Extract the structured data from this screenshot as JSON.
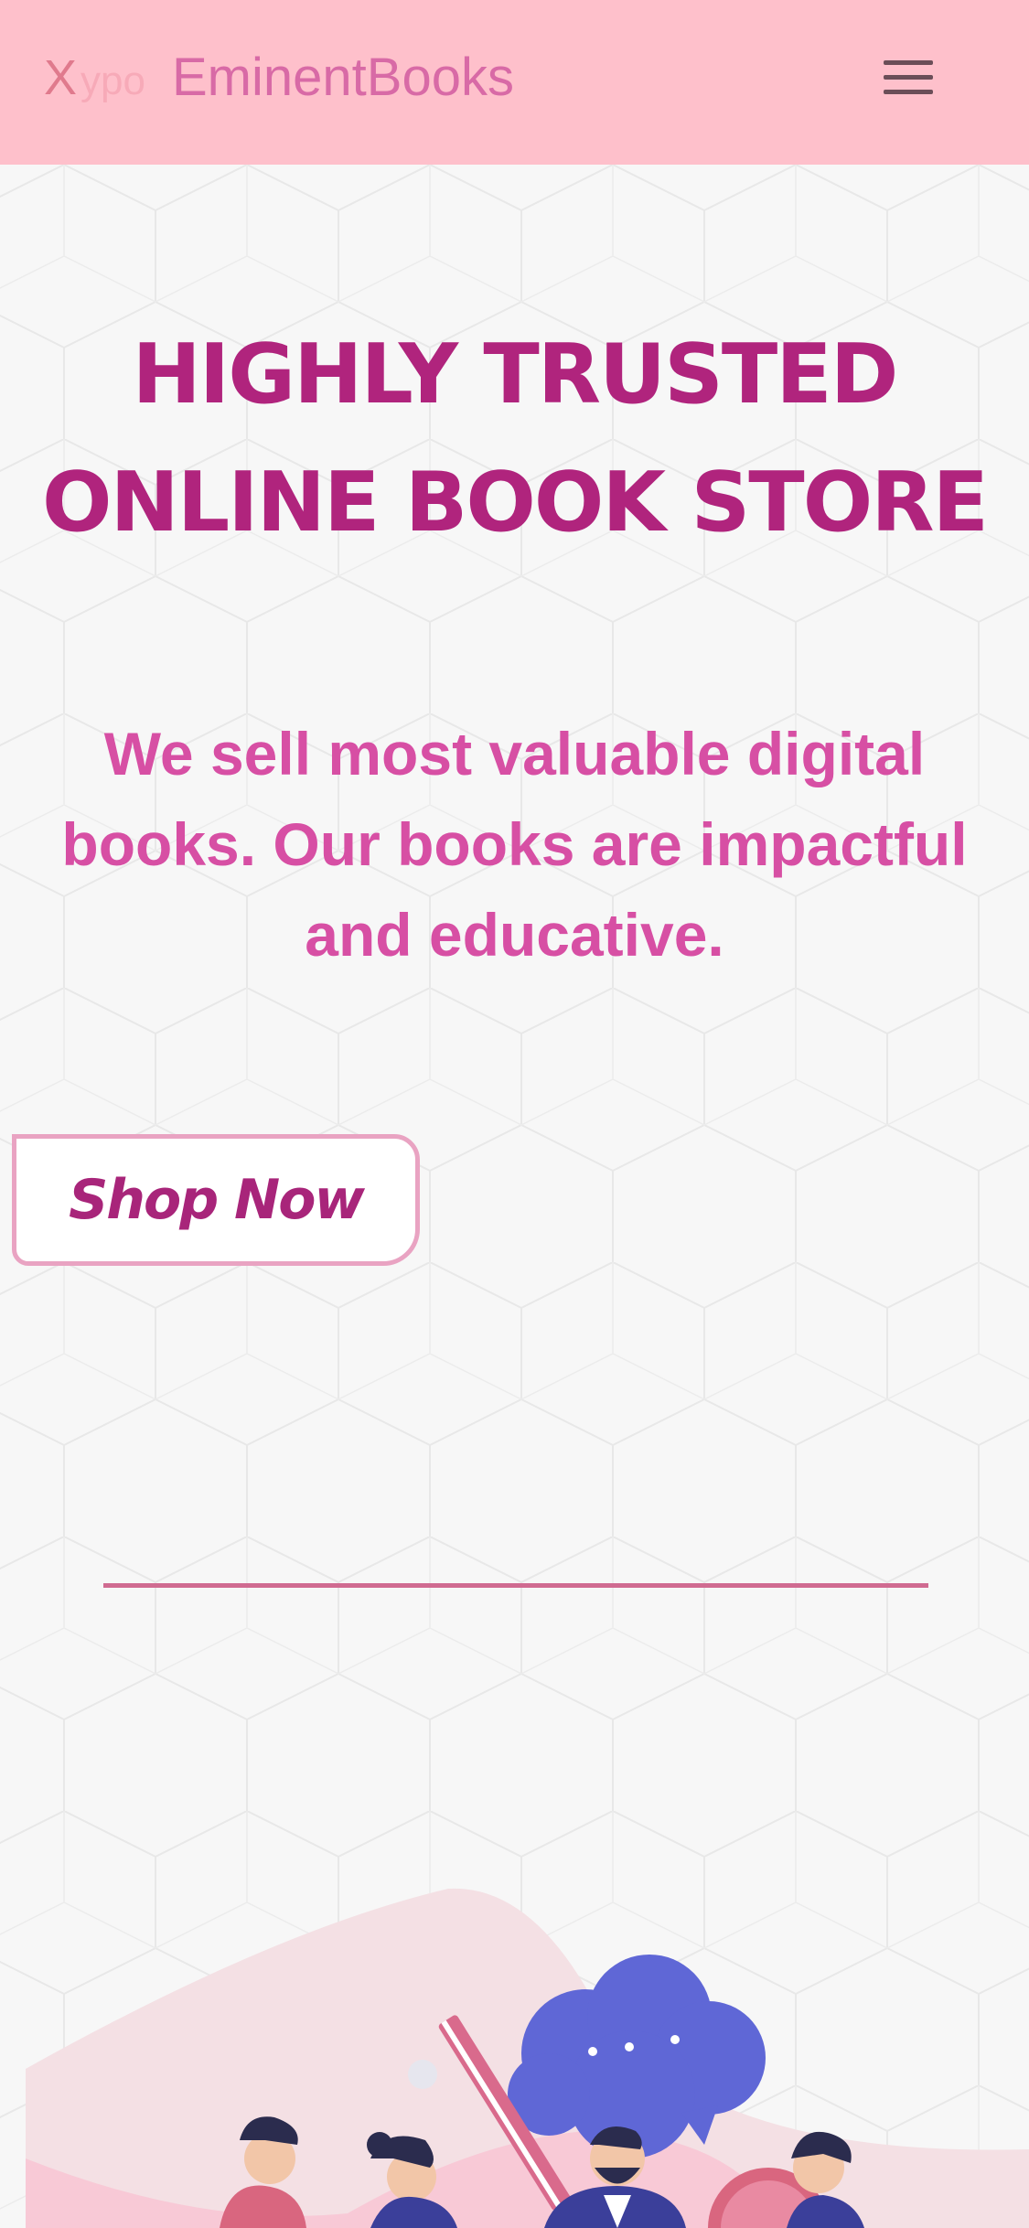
{
  "navbar": {
    "logo_x": "X",
    "logo_ypo": "ypo",
    "brand": "EminentBooks",
    "menu_icon": "hamburger-menu-icon"
  },
  "hero": {
    "title_line1": "HIGHLY TRUSTED",
    "title_line2": "ONLINE BOOK STORE",
    "subtitle": "We sell most valuable digital books. Our books are impactful and educative.",
    "cta_label": "Shop Now"
  },
  "colors": {
    "navbar_bg": "#fec0cb",
    "title": "#b0247d",
    "subtitle": "#d74fa4",
    "divider": "#d06b91",
    "page_bg": "#f7f7f7"
  }
}
